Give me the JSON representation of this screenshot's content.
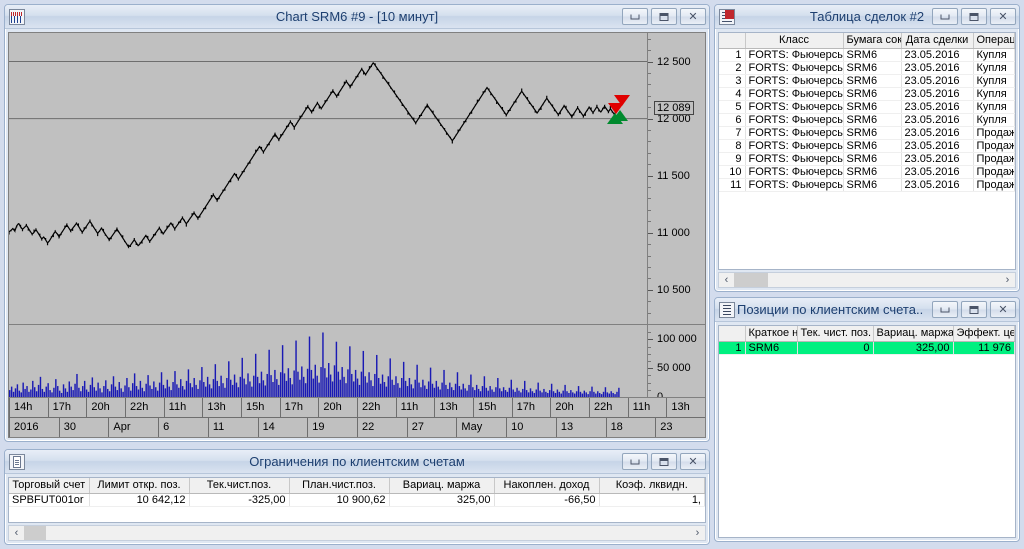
{
  "chart_window": {
    "title": "Chart  SRM6 #9 - [10 минут]",
    "icon": "chart-icon",
    "buttons": {
      "minimize": "minimize",
      "maximize": "maximize",
      "close": "close"
    }
  },
  "chart_data": {
    "type": "line",
    "title": "Chart  SRM6 #9 - [10 минут]",
    "instrument": "SRM6",
    "timeframe": "10 минут",
    "xlabel": "",
    "ylabel": "",
    "grid": true,
    "price_axis": {
      "ticks": [
        10500,
        11000,
        11500,
        12000,
        12500
      ],
      "tick_labels": [
        "10 500",
        "11 000",
        "11 500",
        "12 000",
        "12 500"
      ],
      "ylim": [
        10200,
        12750
      ],
      "current_price_label": "12 089",
      "current_price": 12089
    },
    "volume_axis": {
      "ticks": [
        0,
        50000,
        100000
      ],
      "tick_labels": [
        "0",
        "50 000",
        "100 000"
      ],
      "ylim": [
        0,
        115000
      ]
    },
    "time_axis": {
      "hours": [
        "14h",
        "17h",
        "20h",
        "22h",
        "11h",
        "13h",
        "15h",
        "17h",
        "20h",
        "22h",
        "11h",
        "13h",
        "15h",
        "17h",
        "20h",
        "22h",
        "11h",
        "13h"
      ],
      "dates": [
        "2016",
        "30",
        "Apr",
        "6",
        "11",
        "14",
        "19",
        "22",
        "27",
        "May",
        "10",
        "13",
        "18",
        "23"
      ]
    },
    "markers": [
      {
        "type": "sell",
        "label": "Продажа",
        "color": "#e00000"
      },
      {
        "type": "sell",
        "label": "Продажа",
        "color": "#e00000"
      },
      {
        "type": "buy",
        "label": "Купля",
        "color": "#008a2e"
      },
      {
        "type": "buy",
        "label": "Купля",
        "color": "#008a2e"
      }
    ],
    "series": [
      {
        "name": "SRM6 price",
        "color": "#000000",
        "values": [
          11008,
          11020,
          11036,
          11014,
          11060,
          11082,
          11052,
          11030,
          11046,
          11064,
          11040,
          11012,
          10988,
          11004,
          11026,
          11000,
          10972,
          10946,
          10962,
          10938,
          10910,
          10930,
          10958,
          10986,
          11010,
          10990,
          10964,
          10992,
          11018,
          11044,
          11068,
          11042,
          11016,
          11038,
          11060,
          11082,
          11058,
          11030,
          11004,
          11028,
          11052,
          11078,
          11100,
          11074,
          11046,
          11020,
          10994,
          11016,
          11040,
          11012,
          10986,
          10962,
          10938,
          10960,
          10984,
          11008,
          11032,
          11006,
          10980,
          10954,
          10928,
          10902,
          10876,
          10890,
          10914,
          10938,
          10912,
          10886,
          10904,
          10928,
          10952,
          10976,
          10950,
          10924,
          10946,
          10970,
          10994,
          11018,
          11040,
          11016,
          10990,
          11014,
          11038,
          11062,
          11086,
          11060,
          11034,
          11058,
          11082,
          11106,
          11130,
          11104,
          11078,
          11102,
          11126,
          11150,
          11174,
          11150,
          11126,
          11150,
          11176,
          11202,
          11228,
          11254,
          11280,
          11306,
          11332,
          11308,
          11284,
          11310,
          11336,
          11362,
          11388,
          11414,
          11440,
          11466,
          11492,
          11518,
          11494,
          11470,
          11496,
          11522,
          11548,
          11574,
          11600,
          11626,
          11652,
          11678,
          11704,
          11730,
          11756,
          11732,
          11708,
          11734,
          11760,
          11786,
          11812,
          11838,
          11864,
          11840,
          11816,
          11842,
          11868,
          11894,
          11920,
          11946,
          11972,
          11948,
          11924,
          11950,
          11976,
          12002,
          12028,
          12054,
          12080,
          12106,
          12082,
          12058,
          12084,
          12110,
          12136,
          12112,
          12088,
          12114,
          12140,
          12166,
          12192,
          12218,
          12244,
          12220,
          12196,
          12222,
          12248,
          12274,
          12300,
          12326,
          12302,
          12278,
          12304,
          12330,
          12356,
          12382,
          12408,
          12434,
          12410,
          12386,
          12412,
          12438,
          12464,
          12490,
          12466,
          12442,
          12418,
          12394,
          12370,
          12346,
          12322,
          12298,
          12274,
          12250,
          12226,
          12202,
          12178,
          12154,
          12130,
          12106,
          12082,
          12058,
          12034,
          12010,
          11986,
          11962,
          11988,
          12014,
          12040,
          12066,
          12092,
          12118,
          12094,
          12070,
          12046,
          12022,
          11998,
          11974,
          11950,
          11926,
          11902,
          11878,
          11854,
          11830,
          11806,
          11830,
          11856,
          11882,
          11908,
          11934,
          11960,
          11986,
          12012,
          12038,
          12064,
          12090,
          12116,
          12142,
          12168,
          12194,
          12220,
          12246,
          12272,
          12248,
          12224,
          12200,
          12176,
          12152,
          12128,
          12104,
          12080,
          12056,
          12032,
          12058,
          12084,
          12110,
          12136,
          12162,
          12188,
          12214,
          12240,
          12216,
          12192,
          12168,
          12144,
          12120,
          12096,
          12072,
          12048,
          12074,
          12100,
          12126,
          12152,
          12178,
          12154,
          12130,
          12106,
          12082,
          12058,
          12034,
          12060,
          12086,
          12112,
          12088,
          12064,
          12040,
          12016,
          12042,
          12068,
          12094,
          12070,
          12046,
          12022,
          12048,
          12074,
          12100,
          12076,
          12052,
          12078,
          12104,
          12080,
          12056,
          12082,
          12108,
          12084,
          12060,
          12086,
          12062,
          12038,
          12064,
          12089
        ]
      },
      {
        "name": "Volume",
        "color": "#1a1ab4",
        "type": "bar",
        "values": [
          12,
          18,
          9,
          15,
          22,
          11,
          8,
          25,
          14,
          19,
          9,
          13,
          28,
          17,
          10,
          21,
          35,
          14,
          9,
          18,
          24,
          12,
          8,
          16,
          31,
          19,
          11,
          7,
          22,
          15,
          9,
          27,
          18,
          12,
          23,
          40,
          16,
          10,
          19,
          28,
          13,
          9,
          21,
          34,
          17,
          11,
          25,
          15,
          8,
          19,
          29,
          14,
          10,
          22,
          36,
          18,
          12,
          26,
          15,
          9,
          20,
          33,
          17,
          11,
          24,
          41,
          19,
          13,
          28,
          16,
          10,
          23,
          38,
          20,
          14,
          27,
          17,
          11,
          25,
          43,
          21,
          15,
          30,
          18,
          12,
          26,
          45,
          22,
          16,
          31,
          19,
          13,
          28,
          48,
          24,
          17,
          33,
          21,
          14,
          29,
          52,
          26,
          18,
          35,
          22,
          15,
          31,
          57,
          28,
          19,
          37,
          24,
          16,
          33,
          62,
          30,
          21,
          39,
          25,
          17,
          35,
          68,
          32,
          22,
          41,
          27,
          18,
          37,
          75,
          35,
          24,
          44,
          29,
          20,
          40,
          82,
          38,
          26,
          47,
          31,
          21,
          43,
          90,
          41,
          28,
          50,
          33,
          22,
          46,
          98,
          44,
          30,
          53,
          35,
          24,
          49,
          105,
          47,
          32,
          56,
          37,
          25,
          52,
          112,
          50,
          34,
          59,
          39,
          27,
          55,
          96,
          44,
          30,
          52,
          35,
          24,
          48,
          88,
          40,
          27,
          47,
          32,
          21,
          44,
          80,
          36,
          25,
          43,
          29,
          19,
          40,
          73,
          33,
          23,
          39,
          26,
          18,
          36,
          67,
          30,
          21,
          36,
          24,
          16,
          33,
          61,
          28,
          19,
          33,
          22,
          15,
          30,
          56,
          25,
          17,
          30,
          20,
          14,
          27,
          51,
          23,
          16,
          28,
          18,
          13,
          25,
          47,
          21,
          14,
          25,
          17,
          12,
          23,
          43,
          19,
          13,
          23,
          15,
          11,
          21,
          39,
          17,
          12,
          21,
          14,
          10,
          19,
          36,
          16,
          11,
          19,
          13,
          9,
          17,
          33,
          15,
          10,
          17,
          12,
          9,
          16,
          30,
          13,
          9,
          16,
          11,
          8,
          14,
          28,
          12,
          8,
          15,
          10,
          7,
          13,
          25,
          11,
          8,
          14,
          9,
          7,
          12,
          23,
          10,
          7,
          13,
          9,
          6,
          11,
          21,
          10,
          7,
          12,
          8,
          6,
          10,
          19,
          9,
          6,
          11,
          8,
          5,
          10,
          18,
          9,
          6,
          10,
          7,
          5,
          9,
          17,
          8,
          6,
          10,
          7,
          5,
          9,
          16
        ]
      }
    ]
  },
  "trades_window": {
    "title": "Таблица сделок #2",
    "icon": "trades-table-icon",
    "columns": [
      "",
      "Класс",
      "Бумага сокр",
      "Дата сделки",
      "Операци"
    ],
    "rows": [
      {
        "idx": "1",
        "class": "FORTS: Фьючерсы",
        "ticker": "SRM6",
        "date": "23.05.2016",
        "operation": "Купля"
      },
      {
        "idx": "2",
        "class": "FORTS: Фьючерсы",
        "ticker": "SRM6",
        "date": "23.05.2016",
        "operation": "Купля"
      },
      {
        "idx": "3",
        "class": "FORTS: Фьючерсы",
        "ticker": "SRM6",
        "date": "23.05.2016",
        "operation": "Купля"
      },
      {
        "idx": "4",
        "class": "FORTS: Фьючерсы",
        "ticker": "SRM6",
        "date": "23.05.2016",
        "operation": "Купля"
      },
      {
        "idx": "5",
        "class": "FORTS: Фьючерсы",
        "ticker": "SRM6",
        "date": "23.05.2016",
        "operation": "Купля"
      },
      {
        "idx": "6",
        "class": "FORTS: Фьючерсы",
        "ticker": "SRM6",
        "date": "23.05.2016",
        "operation": "Купля"
      },
      {
        "idx": "7",
        "class": "FORTS: Фьючерсы",
        "ticker": "SRM6",
        "date": "23.05.2016",
        "operation": "Продажа"
      },
      {
        "idx": "8",
        "class": "FORTS: Фьючерсы",
        "ticker": "SRM6",
        "date": "23.05.2016",
        "operation": "Продажа"
      },
      {
        "idx": "9",
        "class": "FORTS: Фьючерсы",
        "ticker": "SRM6",
        "date": "23.05.2016",
        "operation": "Продажа"
      },
      {
        "idx": "10",
        "class": "FORTS: Фьючерсы",
        "ticker": "SRM6",
        "date": "23.05.2016",
        "operation": "Продажа"
      },
      {
        "idx": "11",
        "class": "FORTS: Фьючерсы",
        "ticker": "SRM6",
        "date": "23.05.2016",
        "operation": "Продажа"
      }
    ],
    "scroll": {
      "left_arrow": "‹",
      "right_arrow": "›"
    }
  },
  "positions_window": {
    "title": "Позиции по клиентским счета...",
    "icon": "positions-icon",
    "columns": [
      "",
      "Краткое н",
      "Тек. чист. поз.",
      "Вариац. маржа",
      "Эффект. цена по"
    ],
    "rows": [
      {
        "idx": "1",
        "short_name": "SRM6",
        "net_position": "0",
        "variation_margin": "325,00",
        "effective_price": "11 976",
        "highlight": true
      }
    ],
    "highlight_color": "#00f080"
  },
  "limits_window": {
    "title": "Ограничения по клиентским счетам",
    "icon": "limits-document-icon",
    "columns": [
      "Торговый счет",
      "Лимит откр. поз.",
      "Тек.чист.поз.",
      "План.чист.поз.",
      "Вариац. маржа",
      "Накоплен. доход",
      "Коэф. лквидн."
    ],
    "rows": [
      {
        "account": "SPBFUT001or",
        "open_position_limit": "10 642,12",
        "current_net_position": "-325,00",
        "planned_net_position": "10 900,62",
        "variation_margin": "325,00",
        "accumulated_income": "-66,50",
        "liquidity_ratio": "1,"
      }
    ],
    "scroll": {
      "left_arrow": "‹",
      "right_arrow": "›"
    }
  }
}
